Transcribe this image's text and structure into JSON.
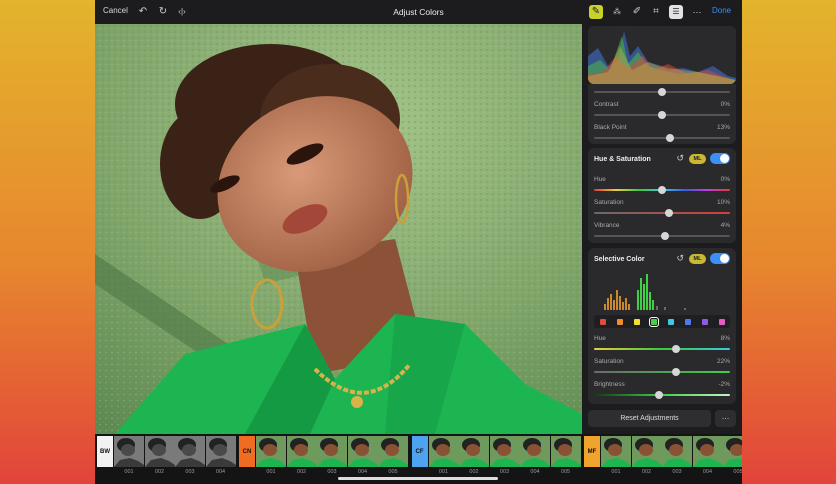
{
  "app": {
    "title": "Adjust Colors",
    "cancel_label": "Cancel",
    "done_label": "Done"
  },
  "toolbar_icons": [
    "undo-icon",
    "redo-icon",
    "compare-icon",
    "adjust-icon",
    "magic-wand-icon",
    "brush-icon",
    "crop-icon",
    "layers-icon",
    "more-icon"
  ],
  "panel": {
    "top_rows": [
      {
        "label": "Contrast",
        "value": "0%",
        "pos": 0.5
      },
      {
        "label": "Black Point",
        "value": "13%",
        "pos": 0.56
      }
    ],
    "hue_saturation": {
      "title": "Hue & Saturation",
      "ml_label": "ML",
      "rows": [
        {
          "label": "Hue",
          "value": "0%",
          "pos": 0.5
        },
        {
          "label": "Saturation",
          "value": "10%",
          "pos": 0.55
        },
        {
          "label": "Vibrance",
          "value": "4%",
          "pos": 0.52
        }
      ]
    },
    "selective_color": {
      "title": "Selective Color",
      "ml_label": "ML",
      "swatch_colors": [
        "#e04b3c",
        "#f08c2e",
        "#f2dc3a",
        "#4ccc4c",
        "#3ec8e6",
        "#4a7cf0",
        "#8e5ae6",
        "#e65ac4"
      ],
      "selected_swatch": 3,
      "rows": [
        {
          "label": "Hue",
          "value": "8%",
          "pos": 0.6
        },
        {
          "label": "Saturation",
          "value": "22%",
          "pos": 0.6
        },
        {
          "label": "Brightness",
          "value": "-2%",
          "pos": 0.48
        }
      ]
    },
    "reset_label": "Reset Adjustments",
    "more_label": "…"
  },
  "filmstrip": {
    "groups": [
      {
        "tag": "BW",
        "color": "#f2f2f2",
        "text_color": "#111",
        "mono": true,
        "labels": [
          "001",
          "002",
          "003",
          "004"
        ]
      },
      {
        "tag": "CN",
        "color": "#f06c22",
        "text_color": "#111",
        "mono": false,
        "labels": [
          "001",
          "002",
          "003",
          "004",
          "005"
        ]
      },
      {
        "tag": "CF",
        "color": "#4ea3f0",
        "text_color": "#111",
        "mono": false,
        "labels": [
          "001",
          "002",
          "003",
          "004",
          "005"
        ]
      },
      {
        "tag": "MF",
        "color": "#f0a42c",
        "text_color": "#111",
        "mono": false,
        "labels": [
          "001",
          "002",
          "003",
          "004",
          "005"
        ]
      }
    ]
  },
  "colors": {
    "accent": "#3b8ff5",
    "wall_green": "#7fa56a",
    "jacket_green": "#1db552"
  }
}
